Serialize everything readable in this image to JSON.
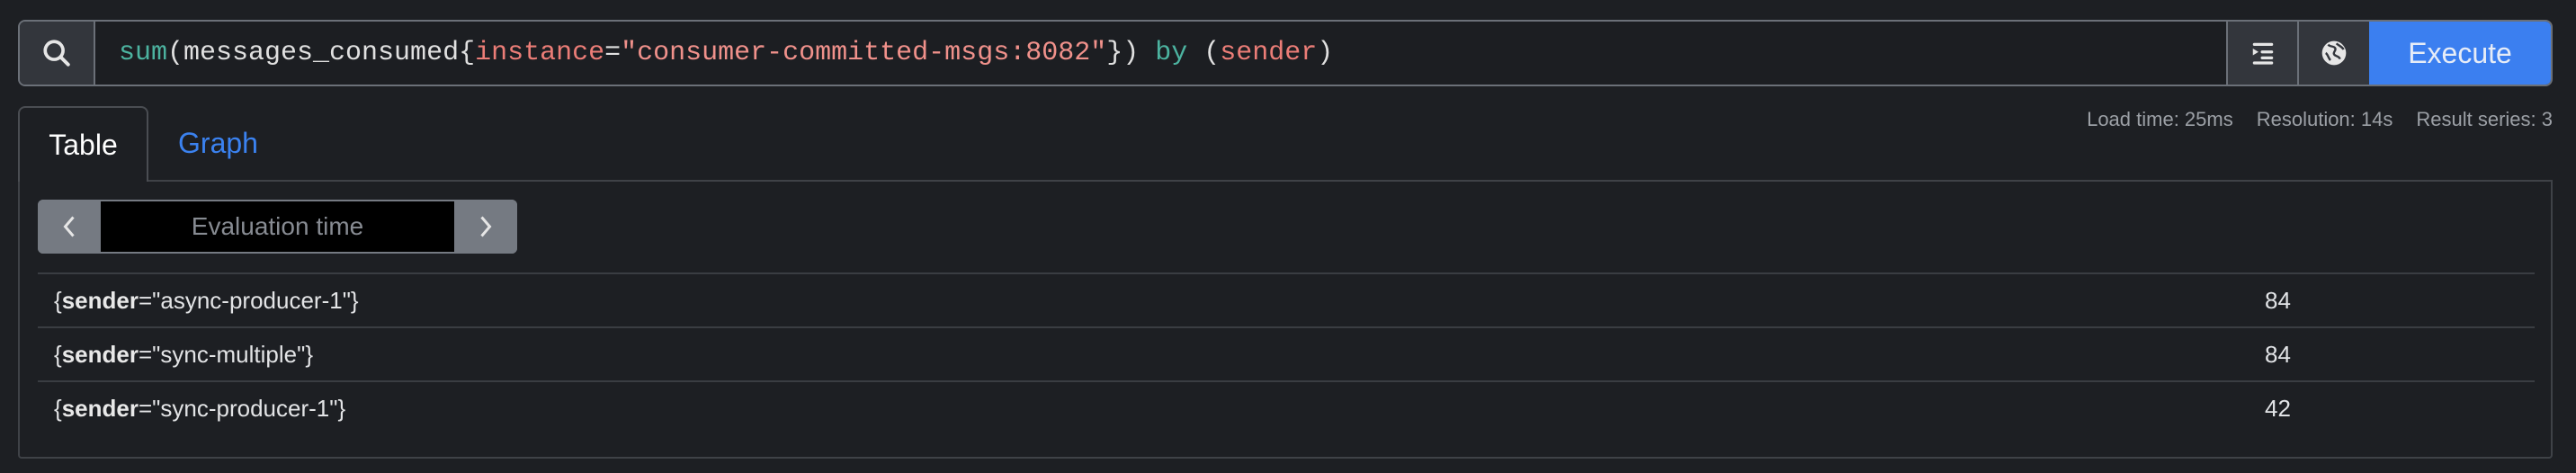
{
  "query_bar": {
    "search_icon": "search-icon",
    "expression_tokens": [
      {
        "type": "fn",
        "text": "sum"
      },
      {
        "type": "plain",
        "text": "(messages_consumed{"
      },
      {
        "type": "label",
        "text": "instance"
      },
      {
        "type": "plain",
        "text": "="
      },
      {
        "type": "str",
        "text": "\"consumer-committed-msgs:8082\""
      },
      {
        "type": "plain",
        "text": "}) "
      },
      {
        "type": "kw",
        "text": "by"
      },
      {
        "type": "plain",
        "text": " ("
      },
      {
        "type": "label",
        "text": "sender"
      },
      {
        "type": "plain",
        "text": ")"
      }
    ],
    "format_icon": "format-expression-icon",
    "metrics_explorer_icon": "globe-icon",
    "execute_label": "Execute"
  },
  "tabs": [
    {
      "label": "Table",
      "active": true
    },
    {
      "label": "Graph",
      "active": false
    }
  ],
  "stats": {
    "load_time": "Load time: 25ms",
    "resolution": "Resolution: 14s",
    "result_series": "Result series: 3"
  },
  "eval_time": {
    "placeholder": "Evaluation time",
    "prev_icon": "chevron-left-icon",
    "next_icon": "chevron-right-icon"
  },
  "results": [
    {
      "label_name": "sender",
      "label_value": "async-producer-1",
      "value": "84"
    },
    {
      "label_name": "sender",
      "label_value": "sync-multiple",
      "value": "84"
    },
    {
      "label_name": "sender",
      "label_value": "sync-producer-1",
      "value": "42"
    }
  ],
  "colors": {
    "accent": "#3b7ff0",
    "background": "#1d1f23",
    "function_token": "#4cb3a0",
    "label_token": "#eb7d77"
  }
}
